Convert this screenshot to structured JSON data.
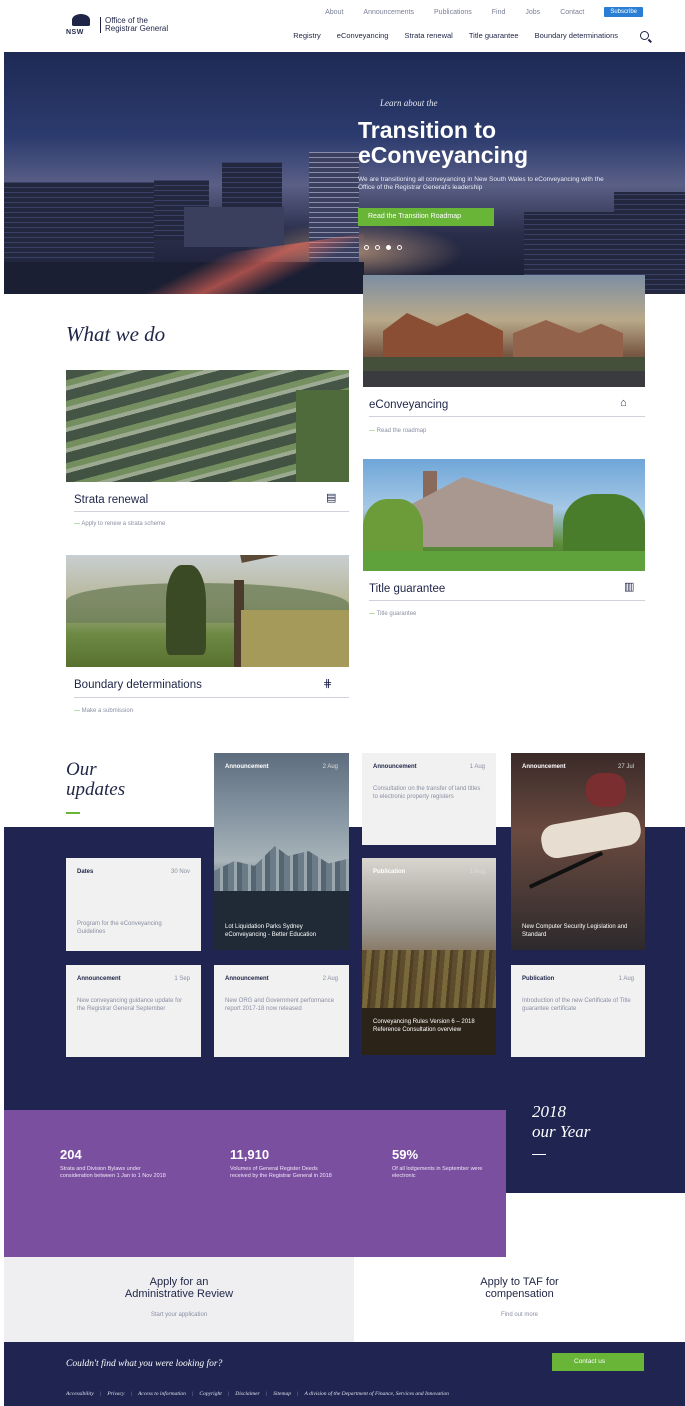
{
  "header": {
    "logo_badge": "NSW",
    "logo_line1": "Office of the",
    "logo_line2": "Registrar General",
    "utility_links": [
      "About",
      "Announcements",
      "Publications",
      "Find",
      "Jobs",
      "Contact"
    ],
    "subscribe_label": "Subscribe",
    "nav_items": [
      "Registry",
      "eConveyancing",
      "Strata renewal",
      "Title guarantee",
      "Boundary determinations"
    ]
  },
  "hero": {
    "kicker": "Learn about the",
    "title_line1": "Transition to",
    "title_line2": "eConveyancing",
    "subtitle": "We are transitioning all conveyancing in New South Wales to eConveyancing with the Office of the Registrar General's leadership",
    "button_label": "Read the Transition Roadmap"
  },
  "what_we_do": {
    "title": "What we do",
    "tiles": [
      {
        "title": "eConveyancing",
        "link": "Read the roadmap"
      },
      {
        "title": "Strata renewal",
        "link": "Apply to renew a strata scheme"
      },
      {
        "title": "Title guarantee",
        "link": "Title guarantee"
      },
      {
        "title": "Boundary determinations",
        "link": "Make a submission"
      }
    ]
  },
  "updates": {
    "title_line1": "Our",
    "title_line2": "updates",
    "cards": [
      {
        "category": "Announcement",
        "date": "2 Aug",
        "text": "Lot Liquidation Parks Sydney eConveyancing - Better Education"
      },
      {
        "category": "Announcement",
        "date": "1 Aug",
        "text": "Consultation on the transfer of land titles to electronic property registers"
      },
      {
        "category": "Announcement",
        "date": "27 Jul",
        "text": "New Computer Security Legislation and Standard"
      },
      {
        "category": "Dates",
        "date": "30 Nov",
        "text": "Program for the eConveyancing Guidelines"
      },
      {
        "category": "Publication",
        "date": "1 Aug",
        "text": "Conveyancing Rules Version 6 – 2018 Reference Consultation overview"
      },
      {
        "category": "Announcement",
        "date": "1 Sep",
        "text": "New conveyancing guidance update for the Registrar General September"
      },
      {
        "category": "Announcement",
        "date": "2 Aug",
        "text": "New ORG and Government performance report 2017-18 now released"
      },
      {
        "category": "Publication",
        "date": "1 Aug",
        "text": "Introduction of the new Certificate of Title guarantee certificate"
      }
    ]
  },
  "stats": {
    "items": [
      {
        "number": "204",
        "desc": "Strata and Division Bylaws under consideration between 1 Jan to 1 Nov 2018"
      },
      {
        "number": "11,910",
        "desc": "Volumes of General Register Deeds received by the Registrar General in 2018"
      },
      {
        "number": "59%",
        "desc": "Of all lodgements in September were electronic"
      }
    ],
    "year_line1": "2018",
    "year_line2": "our Year"
  },
  "apply": {
    "left_heading_line1": "Apply for an",
    "left_heading_line2": "Administrative Review",
    "left_link": "Start your application",
    "right_heading_line1": "Apply to TAF for",
    "right_heading_line2": "compensation",
    "right_link": "Find out more"
  },
  "footer": {
    "question": "Couldn't find what you were looking for?",
    "button_label": "Contact us",
    "links": [
      "Accessibility",
      "Privacy",
      "Access to information",
      "Copyright",
      "Disclaimer",
      "Sitemap"
    ],
    "tagline": "A division of the Department of Finance, Services and Innovation"
  },
  "colors": {
    "navy": "#1f2550",
    "green": "#69b538",
    "purple": "#7b4fa0",
    "light_gray": "#f1f1f1"
  }
}
